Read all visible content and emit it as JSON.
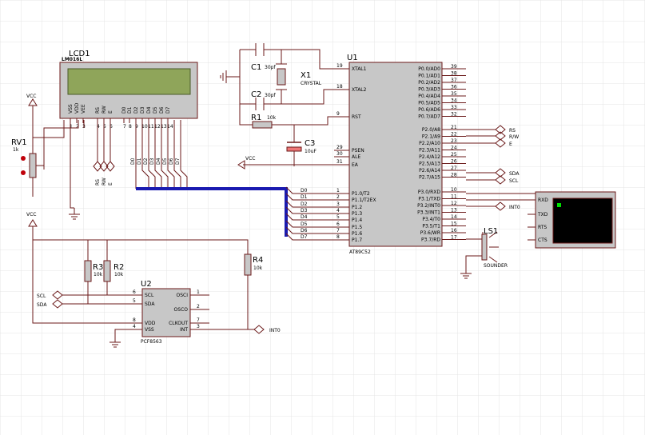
{
  "colors": {
    "grid": "#e4e4e4",
    "wire": "#6b1a1a",
    "body": "#c7c7c7",
    "bus": "#1a1ab0",
    "lcd_screen": "#8fa55a",
    "terminal_screen": "#000000",
    "terminal_led": "#00e000",
    "red_dot": "#c0000a"
  },
  "lcd": {
    "ref": "LCD1",
    "model": "LM016L",
    "pins": [
      "VSS",
      "VDD",
      "VEE",
      "RS",
      "RW",
      "E",
      "D0",
      "D1",
      "D2",
      "D3",
      "D4",
      "D5",
      "D6",
      "D7"
    ],
    "pin_numbers": [
      "1",
      "2",
      "3",
      "4",
      "5",
      "6",
      "7",
      "8",
      "9",
      "10",
      "11",
      "12",
      "13",
      "14"
    ],
    "terminals": [
      "RS",
      "RW",
      "E"
    ],
    "bus_labels": [
      "D0",
      "D1",
      "D2",
      "D3",
      "D4",
      "D5",
      "D6",
      "D7"
    ]
  },
  "mcu": {
    "ref": "U1",
    "model": "AT89C52",
    "left_pins": [
      {
        "label": "XTAL1",
        "num": "19"
      },
      {
        "label": "XTAL2",
        "num": "18"
      },
      {
        "label": "RST",
        "num": "9"
      },
      {
        "label": "PSEN",
        "num": "29"
      },
      {
        "label": "ALE",
        "num": "30"
      },
      {
        "label": "EA",
        "num": "31"
      },
      {
        "label": "P1.0/T2",
        "num": "1"
      },
      {
        "label": "P1.1/T2EX",
        "num": "2"
      },
      {
        "label": "P1.2",
        "num": "3"
      },
      {
        "label": "P1.3",
        "num": "4"
      },
      {
        "label": "P1.4",
        "num": "5"
      },
      {
        "label": "P1.5",
        "num": "6"
      },
      {
        "label": "P1.6",
        "num": "7"
      },
      {
        "label": "P1.7",
        "num": "8"
      }
    ],
    "right_pins_p0": [
      {
        "label": "P0.0/AD0",
        "num": "39"
      },
      {
        "label": "P0.1/AD1",
        "num": "38"
      },
      {
        "label": "P0.2/AD2",
        "num": "37"
      },
      {
        "label": "P0.3/AD3",
        "num": "36"
      },
      {
        "label": "P0.4/AD4",
        "num": "35"
      },
      {
        "label": "P0.5/AD5",
        "num": "34"
      },
      {
        "label": "P0.6/AD6",
        "num": "33"
      },
      {
        "label": "P0.7/AD7",
        "num": "32"
      }
    ],
    "right_pins_p2": [
      {
        "label": "P2.0/A8",
        "num": "21"
      },
      {
        "label": "P2.1/A9",
        "num": "22"
      },
      {
        "label": "P2.2/A10",
        "num": "23"
      },
      {
        "label": "P2.3/A11",
        "num": "24"
      },
      {
        "label": "P2.4/A12",
        "num": "25"
      },
      {
        "label": "P2.5/A13",
        "num": "26"
      },
      {
        "label": "P2.6/A14",
        "num": "27"
      },
      {
        "label": "P2.7/A15",
        "num": "28"
      }
    ],
    "right_pins_p3": [
      {
        "label": "P3.0/RXD",
        "num": "10"
      },
      {
        "label": "P3.1/TXD",
        "num": "11"
      },
      {
        "label": "P3.2/INT0",
        "num": "12"
      },
      {
        "label": "P3.3/INT1",
        "num": "13"
      },
      {
        "label": "P3.4/T0",
        "num": "14"
      },
      {
        "label": "P3.5/T1",
        "num": "15"
      },
      {
        "label": "P3.6/WR",
        "num": "16"
      },
      {
        "label": "P3.7/RD",
        "num": "17"
      }
    ],
    "p1_bus_labels": [
      "D0",
      "D1",
      "D2",
      "D3",
      "D4",
      "D5",
      "D6",
      "D7"
    ],
    "p2_terminals": [
      "RS",
      "R/W",
      "E"
    ],
    "p2_sda_scl": [
      "SDA",
      "SCL"
    ],
    "int0_terminal": "INT0"
  },
  "crystal": {
    "c1_ref": "C1",
    "c1_val": "30pf",
    "c2_ref": "C2",
    "c2_val": "30pf",
    "x1_ref": "X1",
    "x1_val": "CRYSTAL"
  },
  "reset": {
    "r1_ref": "R1",
    "r1_val": "10k",
    "c3_ref": "C3",
    "c3_val": "10uF"
  },
  "power": {
    "vcc": "VCC"
  },
  "pot": {
    "ref": "RV1",
    "val": "1k"
  },
  "rtc": {
    "ref": "U2",
    "model": "PCF8563",
    "left_pins": [
      {
        "label": "SCL",
        "num": "6"
      },
      {
        "label": "SDA",
        "num": "5"
      },
      {
        "label": "VDD",
        "num": "8"
      },
      {
        "label": "VSS",
        "num": "4"
      }
    ],
    "right_pins": [
      {
        "label": "OSCI",
        "num": "1"
      },
      {
        "label": "OSCO",
        "num": "2"
      },
      {
        "label": "CLKOUT",
        "num": "7"
      },
      {
        "label": "INT",
        "num": "3"
      }
    ],
    "terminals": [
      "SCL",
      "SDA"
    ],
    "int_terminal": "INT0"
  },
  "pullups": {
    "r3_ref": "R3",
    "r3_val": "10k",
    "r2_ref": "R2",
    "r2_val": "10k",
    "r4_ref": "R4",
    "r4_val": "10k"
  },
  "speaker": {
    "ref": "LS1",
    "label": "SOUNDER"
  },
  "terminal": {
    "pins": [
      "RXD",
      "TXD",
      "RTS",
      "CTS"
    ]
  }
}
